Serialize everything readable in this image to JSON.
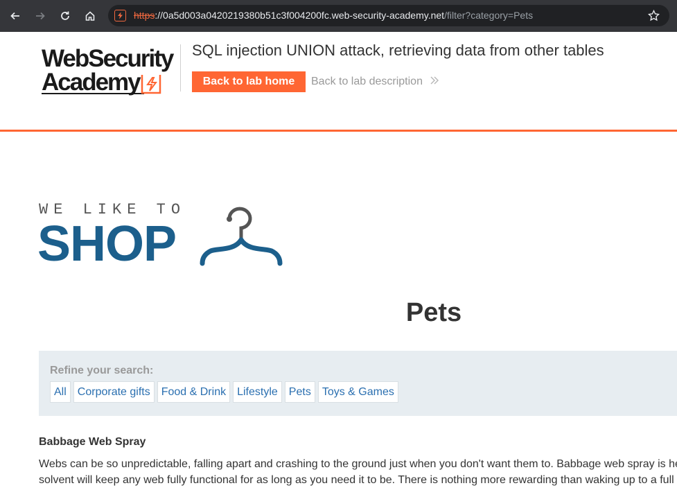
{
  "browser": {
    "url_protocol": "https",
    "url_host": "://0a5d003a0420219380b51c3f004200fc.web-security-academy.net",
    "url_path": "/filter?category=Pets",
    "back_icon": "arrow-left-icon",
    "forward_icon": "arrow-right-icon",
    "reload_icon": "reload-icon",
    "home_icon": "home-icon",
    "bookmark_icon": "star-icon"
  },
  "lab_header": {
    "logo_line1": "WebSecurity",
    "logo_line2": "Academy",
    "title": "SQL injection UNION attack, retrieving data from other tables",
    "back_to_lab_home": "Back to lab home",
    "back_to_lab_description": "Back to lab description",
    "accent_color": "#ff6633"
  },
  "shop_logo": {
    "tagline": "WE LIKE TO",
    "word": "SHOP",
    "brand_color": "#1c5f8c"
  },
  "page": {
    "category_heading": "Pets"
  },
  "filters": {
    "label": "Refine your search:",
    "items": [
      "All",
      "Corporate gifts",
      "Food & Drink",
      "Lifestyle",
      "Pets",
      "Toys & Games"
    ]
  },
  "product": {
    "name": "Babbage Web Spray",
    "description_line1": "Webs can be so unpredictable, falling apart and crashing to the ground just when you don't want them to. Babbage web spray is he",
    "description_line2": "solvent will keep any web fully functional for as long as you need it to be. There is nothing more rewarding than waking up to a full"
  }
}
